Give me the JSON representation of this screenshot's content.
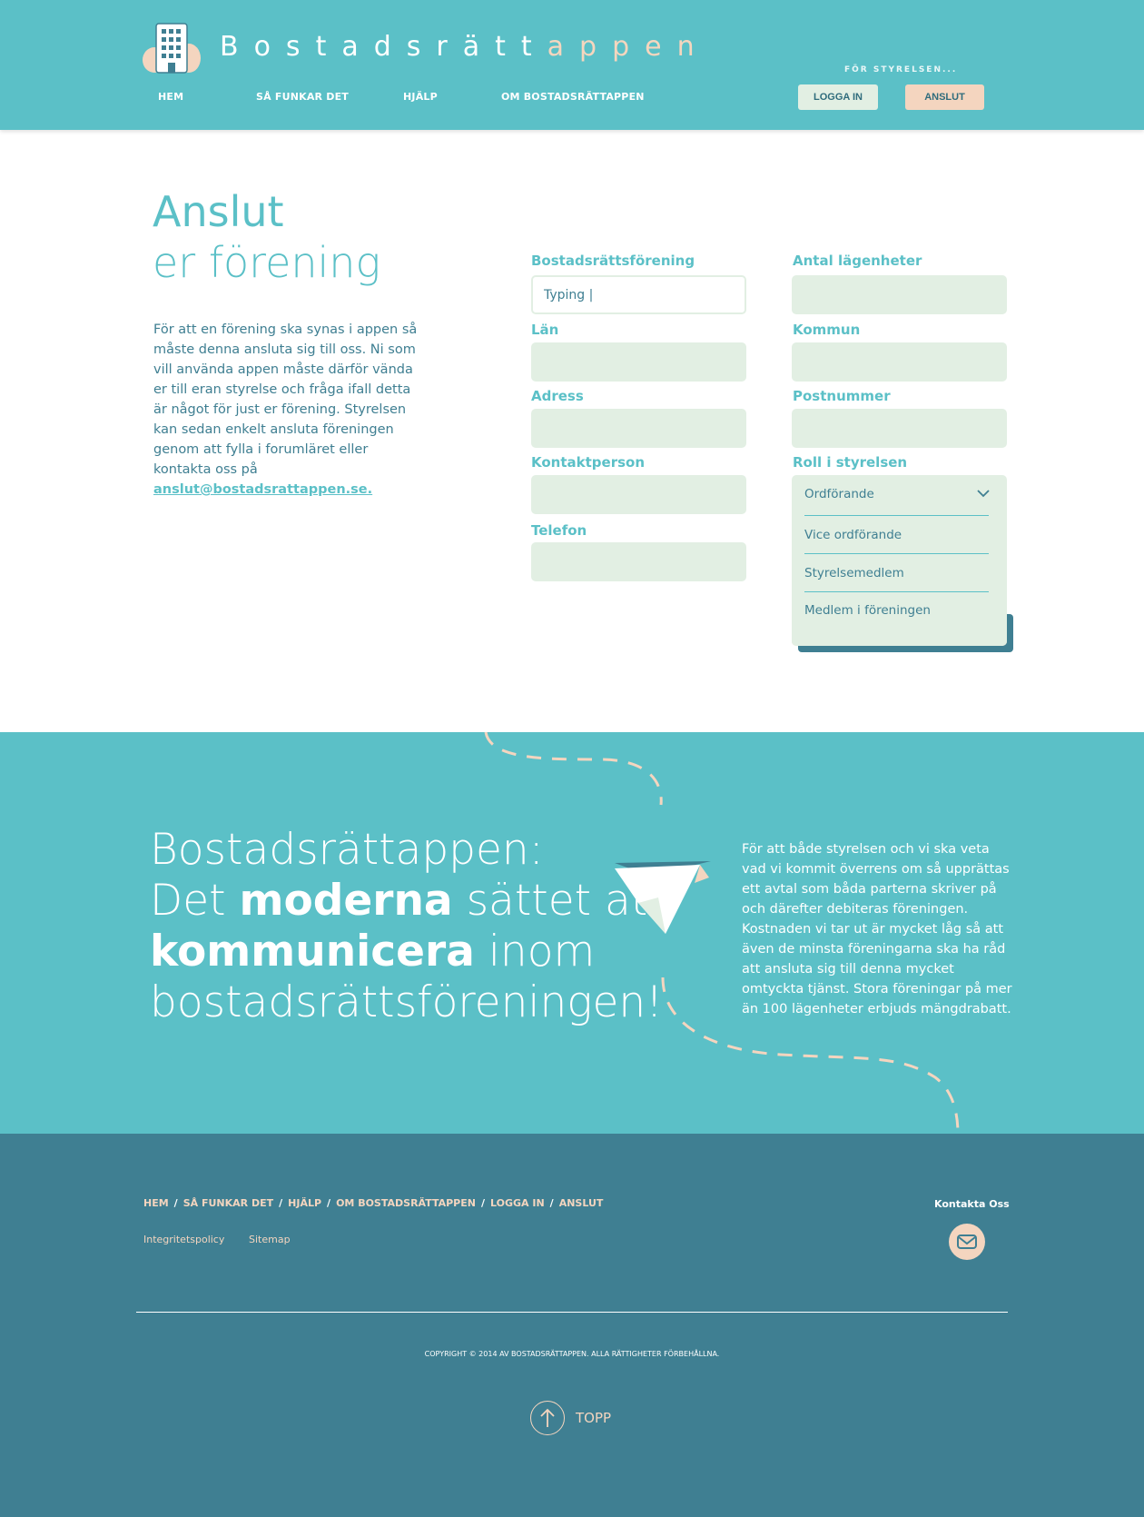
{
  "header": {
    "logo_text_main": "Bostadsrätt",
    "logo_text_accent": "appen",
    "nav": [
      {
        "label": "HEM"
      },
      {
        "label": "SÅ FUNKAR DET"
      },
      {
        "label": "HJÄLP"
      },
      {
        "label": "OM BOSTADSRÄTTAPPEN"
      }
    ],
    "for_styrelsen": "FÖR STYRELSEN...",
    "login_label": "LOGGA IN",
    "anslut_label": "ANSLUT",
    "logo_icon": "building-icon"
  },
  "intro": {
    "title_line1": "Anslut",
    "title_line2": "er förening",
    "body": "För att en förening ska synas i appen så måste denna ansluta sig till oss. Ni som vill använda appen måste därför vända er till eran styrelse och fråga ifall detta är något för just er förening. Styrelsen kan sedan enkelt ansluta föreningen genom att fylla i forumläret eller kontakta oss på",
    "email": "anslut@bostadsrattappen.se."
  },
  "form": {
    "labels": {
      "forening": "Bostadsrättsförening",
      "lan": "Län",
      "adress": "Adress",
      "kontaktperson": "Kontaktperson",
      "telefon": "Telefon",
      "antal": "Antal lägenheter",
      "kommun": "Kommun",
      "postnummer": "Postnummer",
      "roll": "Roll i styrelsen"
    },
    "forening_value": "Typing |",
    "roll_selected": "Ordförande",
    "roll_options": [
      "Vice ordförande",
      "Styrelsemedlem",
      "Medlem i föreningen"
    ]
  },
  "banner": {
    "line1": "Bostadsrättappen:",
    "line2_a": "Det ",
    "line2_b": "moderna",
    "line2_c": " sättet att",
    "line3_a": "kommunicera",
    "line3_b": " inom",
    "line4": "bostadsrättsföreningen!",
    "side_text": "För att både styrelsen och vi ska veta vad vi kommit överrens om så upprättas ett avtal som båda parterna skriver på och därefter debiteras föreningen. Kostnaden vi tar ut är mycket låg så att även de minsta föreningarna ska ha råd att ansluta sig till denna mycket omtyckta tjänst. Stora föreningar på mer än 100 lägenheter erbjuds mängdrabatt.",
    "icon": "paper-plane-icon"
  },
  "footer": {
    "nav": [
      "HEM",
      "SÅ FUNKAR DET",
      "HJÄLP",
      "OM BOSTADSRÄTTAPPEN",
      "LOGGA IN",
      "ANSLUT"
    ],
    "separator": "/",
    "integritet": "Integritetspolicy",
    "sitemap": "Sitemap",
    "kontakta": "Kontakta Oss",
    "copyright": "COPYRIGHT © 2014 AV BOSTADSRÄTTAPPEN. ALLA RÄTTIGHETER FÖRBEHÅLLNA.",
    "topp": "TOPP",
    "mail_icon": "mail-icon",
    "arrow_icon": "arrow-up-icon"
  },
  "colors": {
    "teal": "#5bc0c7",
    "dark_teal": "#3f7f92",
    "peach": "#f4d5bf",
    "mint": "#e2efe3"
  }
}
